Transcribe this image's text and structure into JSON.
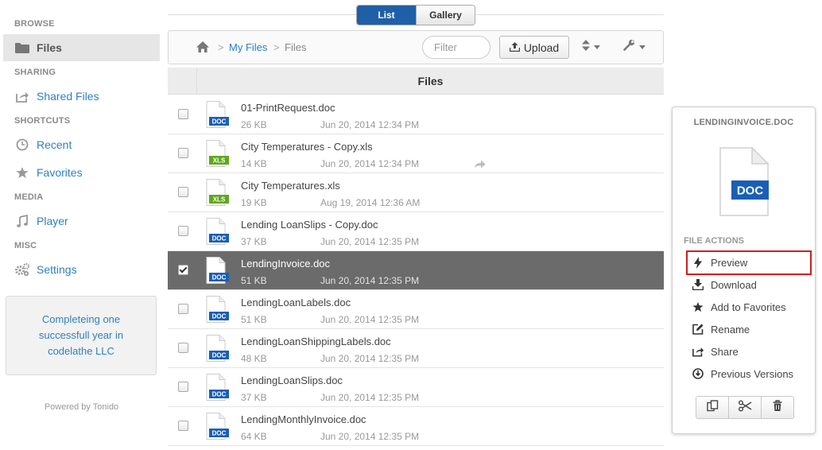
{
  "sidebar": {
    "sections": [
      {
        "title": "BROWSE"
      },
      {
        "title": "SHARING"
      },
      {
        "title": "SHORTCUTS"
      },
      {
        "title": "MEDIA"
      },
      {
        "title": "MISC"
      }
    ],
    "items": [
      {
        "label": "Files",
        "icon": "folder-icon",
        "active": true
      },
      {
        "label": "Shared Files",
        "icon": "share-icon"
      },
      {
        "label": "Recent",
        "icon": "clock-icon"
      },
      {
        "label": "Favorites",
        "icon": "star-icon"
      },
      {
        "label": "Player",
        "icon": "music-icon"
      },
      {
        "label": "Settings",
        "icon": "gears-icon"
      }
    ],
    "promo": "Completeing one successfull year in codelathe LLC",
    "powered": "Powered by Tonido"
  },
  "view_toggle": {
    "list": "List",
    "gallery": "Gallery",
    "selected": "List"
  },
  "toolbar": {
    "breadcrumb": {
      "sep": ">",
      "myfiles": "My Files",
      "current": "Files"
    },
    "filter_placeholder": "Filter",
    "upload_label": "Upload"
  },
  "list": {
    "header": "Files",
    "rows": [
      {
        "name": "01-PrintRequest.doc",
        "size": "26 KB",
        "date": "Jun 20, 2014 12:34 PM",
        "type": "DOC",
        "checked": false
      },
      {
        "name": "City Temperatures - Copy.xls",
        "size": "14 KB",
        "date": "Jun 20, 2014 12:34 PM",
        "type": "XLS",
        "checked": false,
        "shared": true
      },
      {
        "name": "City Temperatures.xls",
        "size": "19 KB",
        "date": "Aug 19, 2014 12:36 AM",
        "type": "XLS",
        "checked": false
      },
      {
        "name": "Lending LoanSlips - Copy.doc",
        "size": "37 KB",
        "date": "Jun 20, 2014 12:35 PM",
        "type": "DOC",
        "checked": false
      },
      {
        "name": "LendingInvoice.doc",
        "size": "51 KB",
        "date": "Jun 20, 2014 12:35 PM",
        "type": "DOC",
        "checked": true
      },
      {
        "name": "LendingLoanLabels.doc",
        "size": "51 KB",
        "date": "Jun 20, 2014 12:35 PM",
        "type": "DOC",
        "checked": false
      },
      {
        "name": "LendingLoanShippingLabels.doc",
        "size": "48 KB",
        "date": "Jun 20, 2014 12:35 PM",
        "type": "DOC",
        "checked": false
      },
      {
        "name": "LendingLoanSlips.doc",
        "size": "37 KB",
        "date": "Jun 20, 2014 12:35 PM",
        "type": "DOC",
        "checked": false
      },
      {
        "name": "LendingMonthlyInvoice.doc",
        "size": "64 KB",
        "date": "Jun 20, 2014 12:35 PM",
        "type": "DOC",
        "checked": false
      }
    ]
  },
  "panel": {
    "title": "LENDINGINVOICE.DOC",
    "doc_badge": "DOC",
    "actions_title": "FILE ACTIONS",
    "actions": [
      {
        "label": "Preview",
        "icon": "bolt-icon",
        "highlighted": true
      },
      {
        "label": "Download",
        "icon": "download-icon"
      },
      {
        "label": "Add to Favorites",
        "icon": "star-icon"
      },
      {
        "label": "Rename",
        "icon": "edit-icon"
      },
      {
        "label": "Share",
        "icon": "share-icon"
      },
      {
        "label": "Previous Versions",
        "icon": "history-icon"
      }
    ]
  },
  "colors": {
    "accent": "#1f5fa8",
    "link": "#2f7fc1",
    "doc": "#1a5fb4",
    "xls": "#5fa81c",
    "selected_row": "#6b6b6b",
    "highlight": "#cc1f1f"
  }
}
